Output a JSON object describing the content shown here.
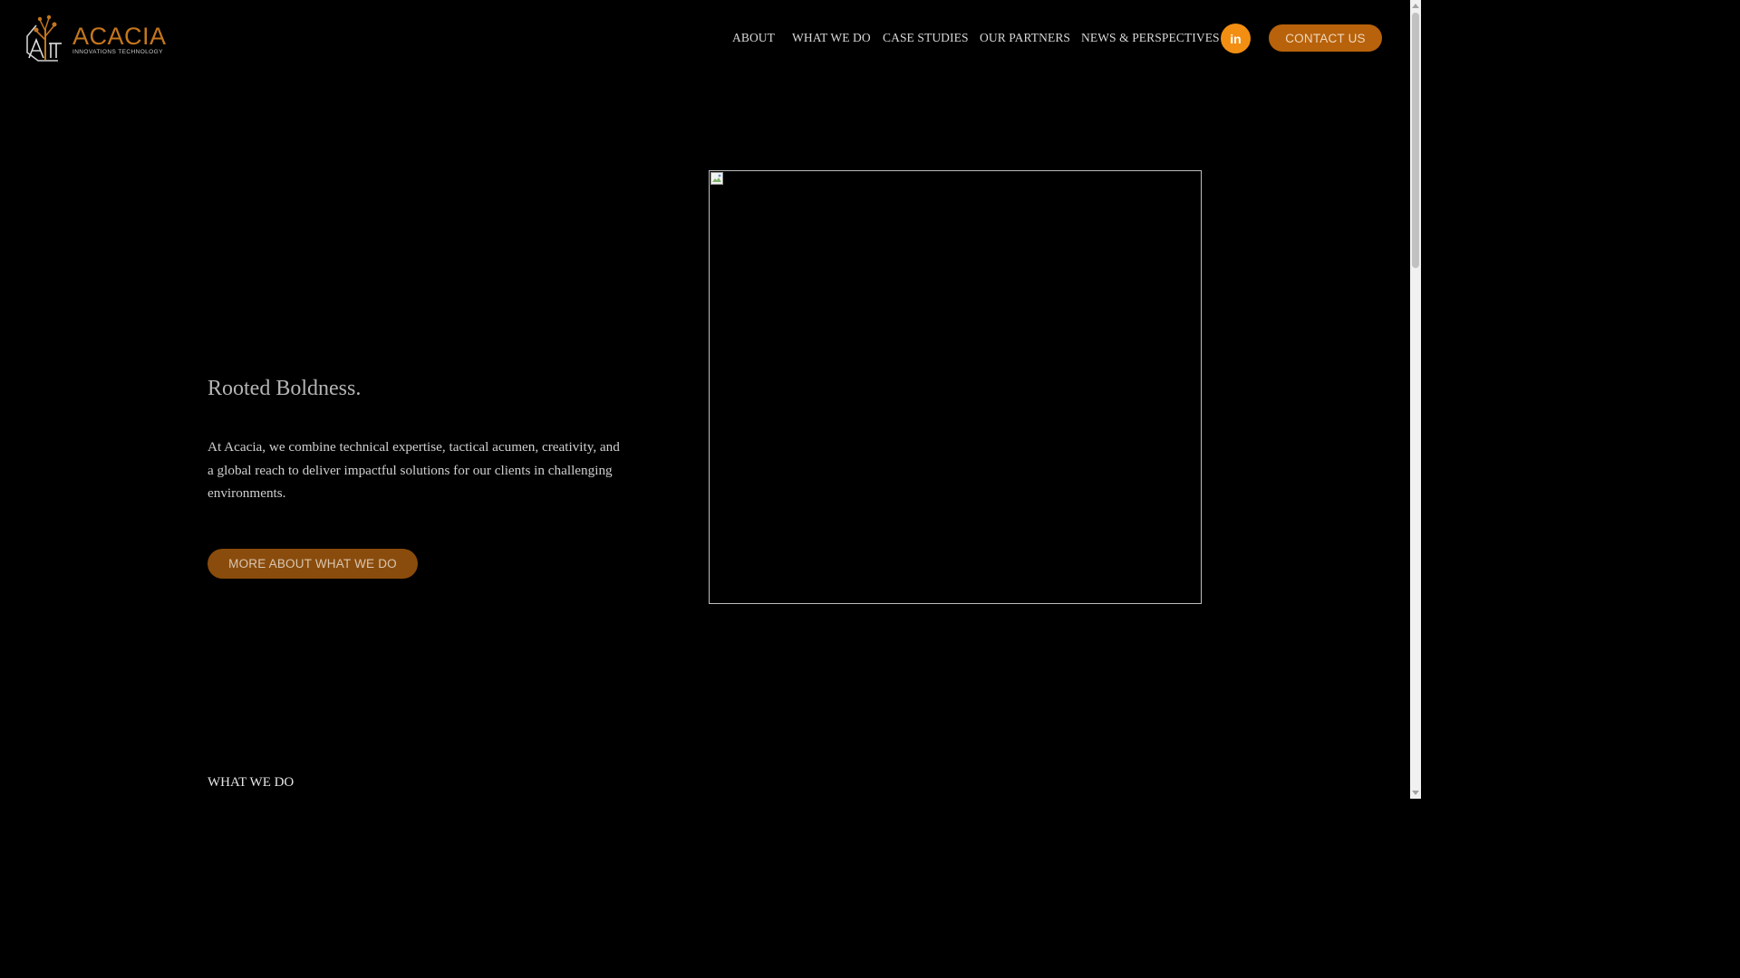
{
  "header": {
    "logo": {
      "word": "ACACIA",
      "sub": "INNOVATIONS TECHNOLOGY",
      "accent_color": "#c5761d"
    },
    "nav": [
      {
        "label": "ABOUT"
      },
      {
        "label": "WHAT WE DO"
      },
      {
        "label": "CASE STUDIES"
      },
      {
        "label": "OUR PARTNERS"
      },
      {
        "label": "NEWS & PERSPECTIVES"
      }
    ],
    "linkedin": {
      "icon": "linkedin-icon",
      "glyph": "in",
      "color": "#f28f13"
    },
    "contact_label": "CONTACT US",
    "contact_color": "#b8620b"
  },
  "hero": {
    "title": "Rooted Boldness.",
    "text": "At Acacia, we combine technical expertise, tactical acumen, creativity, and a global reach to deliver impactful solutions for our clients in challenging environments.",
    "button_label": "MORE ABOUT WHAT WE DO",
    "button_color": "#8a4c0c",
    "image_icon": "broken-image-icon"
  },
  "next_section": {
    "label": "WHAT WE DO"
  }
}
